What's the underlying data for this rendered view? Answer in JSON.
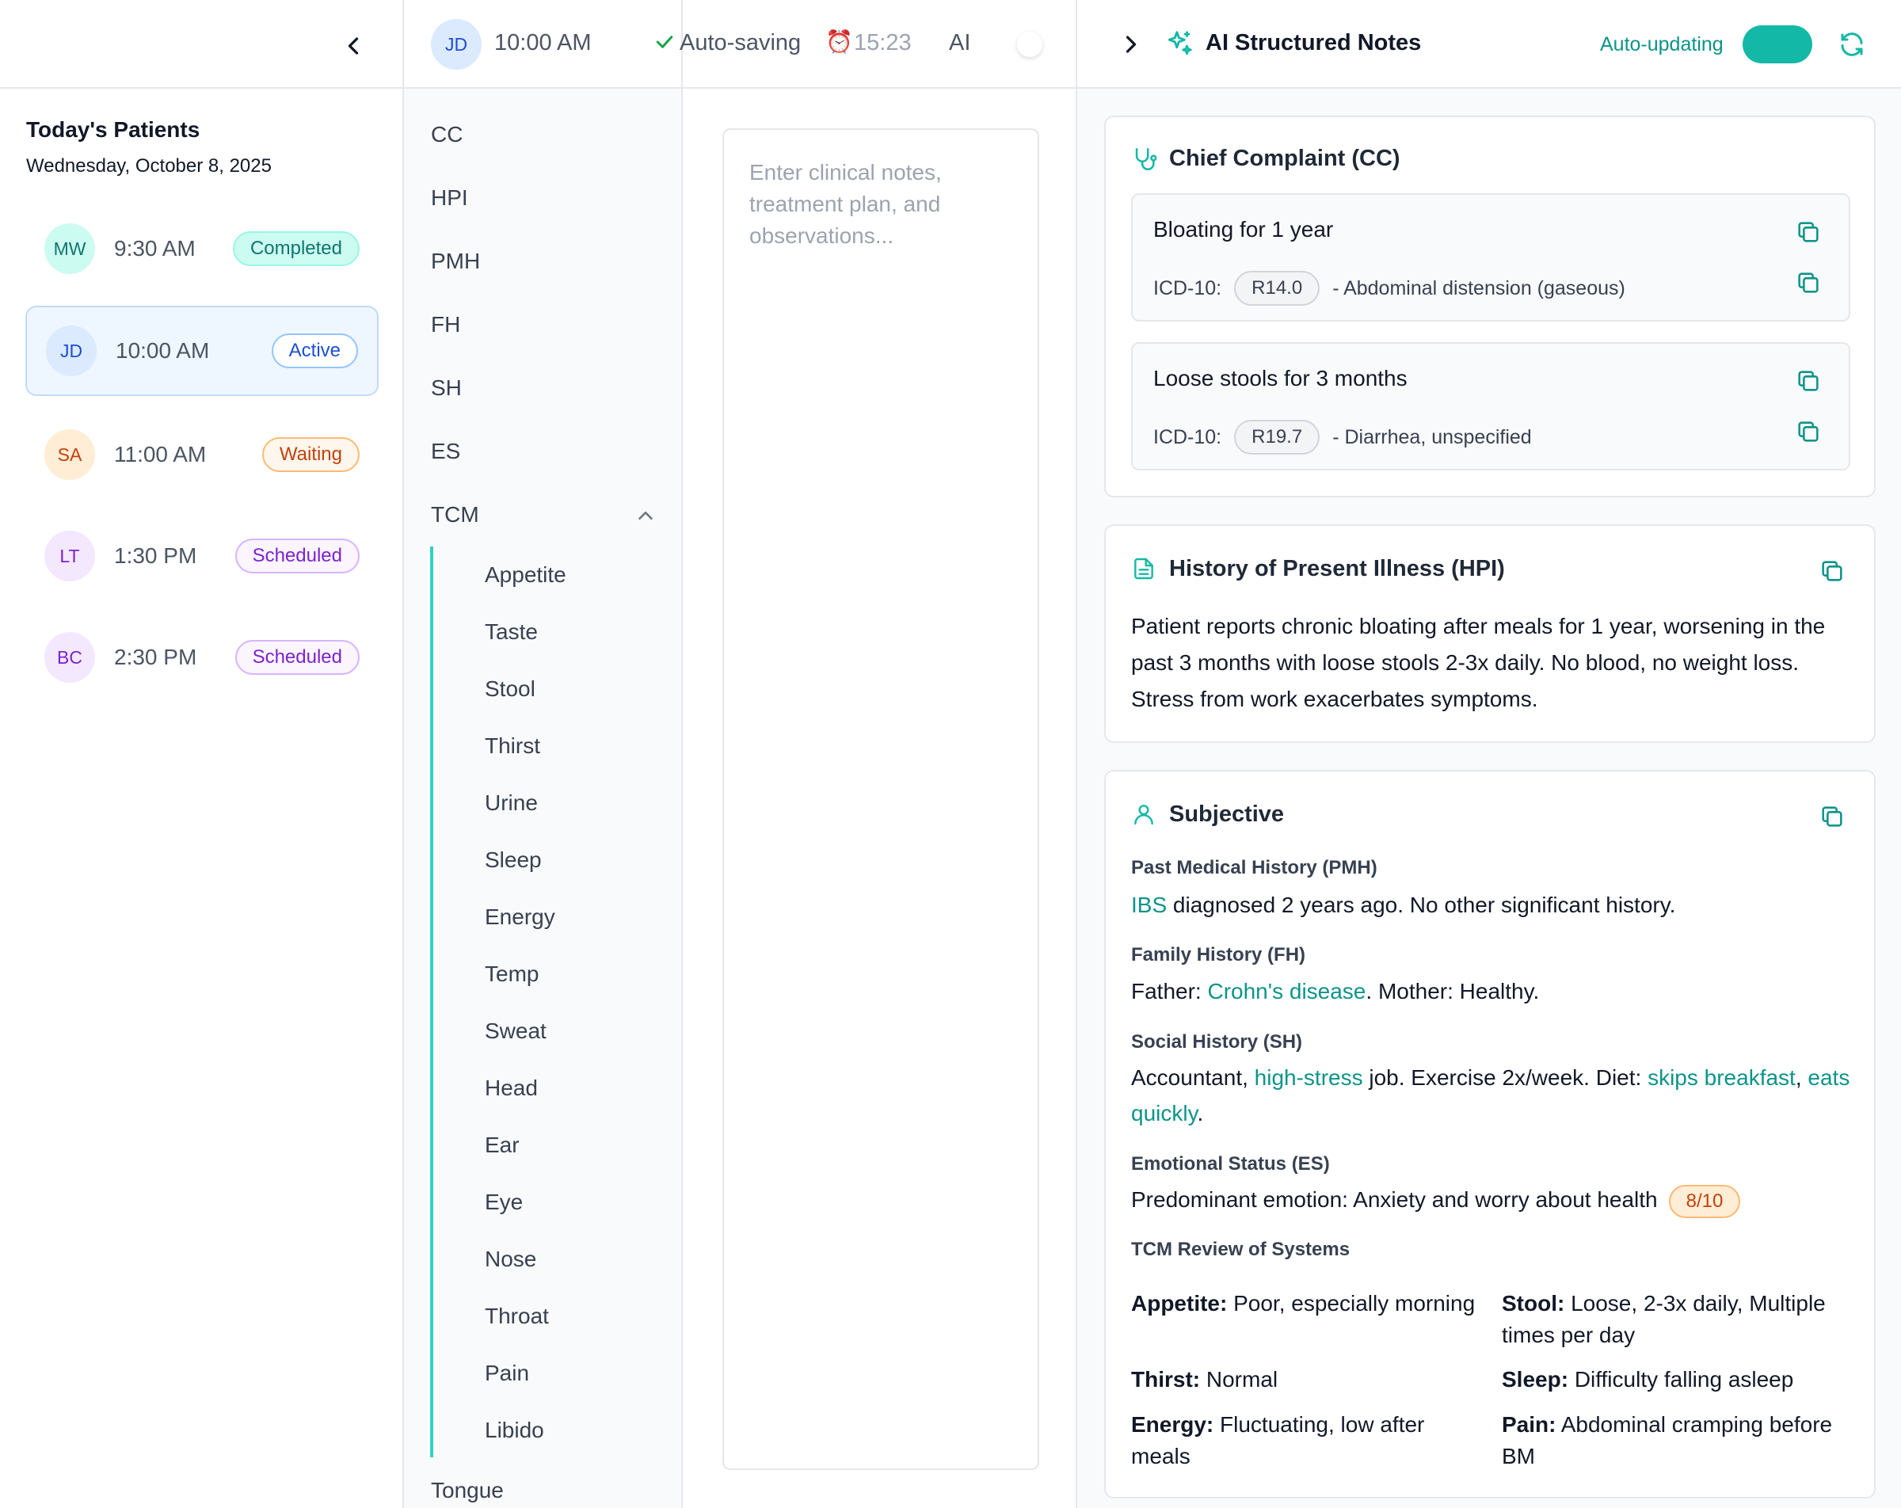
{
  "patients_panel": {
    "title": "Today's Patients",
    "date": "Wednesday, October 8, 2025",
    "patients": [
      {
        "initials": "MW",
        "time": "9:30 AM",
        "status": "Completed"
      },
      {
        "initials": "JD",
        "time": "10:00 AM",
        "status": "Active"
      },
      {
        "initials": "SA",
        "time": "11:00 AM",
        "status": "Waiting"
      },
      {
        "initials": "LT",
        "time": "1:30 PM",
        "status": "Scheduled"
      },
      {
        "initials": "BC",
        "time": "2:30 PM",
        "status": "Scheduled"
      }
    ]
  },
  "session_header": {
    "initials": "JD",
    "time": "10:00 AM",
    "save_status": "Auto-saving",
    "clock_emoji": "⏰",
    "timer": "15:23",
    "ai_label": "AI"
  },
  "sections_nav": {
    "items": [
      "CC",
      "HPI",
      "PMH",
      "FH",
      "SH",
      "ES",
      "TCM"
    ],
    "tcm_subitems": [
      "Appetite",
      "Taste",
      "Stool",
      "Thirst",
      "Urine",
      "Sleep",
      "Energy",
      "Temp",
      "Sweat",
      "Head",
      "Ear",
      "Eye",
      "Nose",
      "Throat",
      "Pain",
      "Libido"
    ],
    "after_tcm": "Tongue"
  },
  "notes_editor": {
    "placeholder": "Enter clinical notes, treatment plan, and observations..."
  },
  "ai_notes": {
    "title": "AI Structured Notes",
    "auto_update_label": "Auto-updating",
    "auto_update_on": true,
    "chief_complaint": {
      "title": "Chief Complaint (CC)",
      "items": [
        {
          "text": "Bloating for 1 year",
          "icd_label": "ICD-10:",
          "code": "R14.0",
          "desc": "- Abdominal distension (gaseous)"
        },
        {
          "text": "Loose stools for 3 months",
          "icd_label": "ICD-10:",
          "code": "R19.7",
          "desc": "- Diarrhea, unspecified"
        }
      ]
    },
    "hpi": {
      "title": "History of Present Illness (HPI)",
      "text": "Patient reports chronic bloating after meals for 1 year, worsening in the past 3 months with loose stools 2-3x daily. No blood, no weight loss. Stress from work exacerbates symptoms."
    },
    "subjective": {
      "title": "Subjective",
      "pmh": {
        "label": "Past Medical History (PMH)",
        "hl": "IBS",
        "rest": " diagnosed 2 years ago. No other significant history."
      },
      "fh": {
        "label": "Family History (FH)",
        "pre": "Father: ",
        "hl": "Crohn's disease",
        "post": ". Mother: Healthy."
      },
      "sh": {
        "label": "Social History (SH)",
        "t1": "Accountant, ",
        "h1": "high-stress",
        "t2": " job. Exercise 2x/week. Diet: ",
        "h2": "skips breakfast",
        "t3": ", ",
        "h3": "eats quickly",
        "t4": "."
      },
      "es": {
        "label": "Emotional Status (ES)",
        "text": "Predominant emotion: Anxiety and worry about health",
        "score": "8/10"
      },
      "tcm": {
        "label": "TCM Review of Systems",
        "entries": [
          {
            "k": "Appetite:",
            "v": "Poor, especially morning"
          },
          {
            "k": "Stool:",
            "v": "Loose, 2-3x daily, Multiple times per day"
          },
          {
            "k": "Thirst:",
            "v": "Normal"
          },
          {
            "k": "Sleep:",
            "v": "Difficulty falling asleep"
          },
          {
            "k": "Energy:",
            "v": "Fluctuating, low after meals"
          },
          {
            "k": "Pain:",
            "v": "Abdominal cramping before BM"
          }
        ]
      }
    }
  },
  "colors": {
    "teal": "#14b8a6",
    "teal_text": "#0d9488",
    "active_blue": "#eef6ff"
  }
}
